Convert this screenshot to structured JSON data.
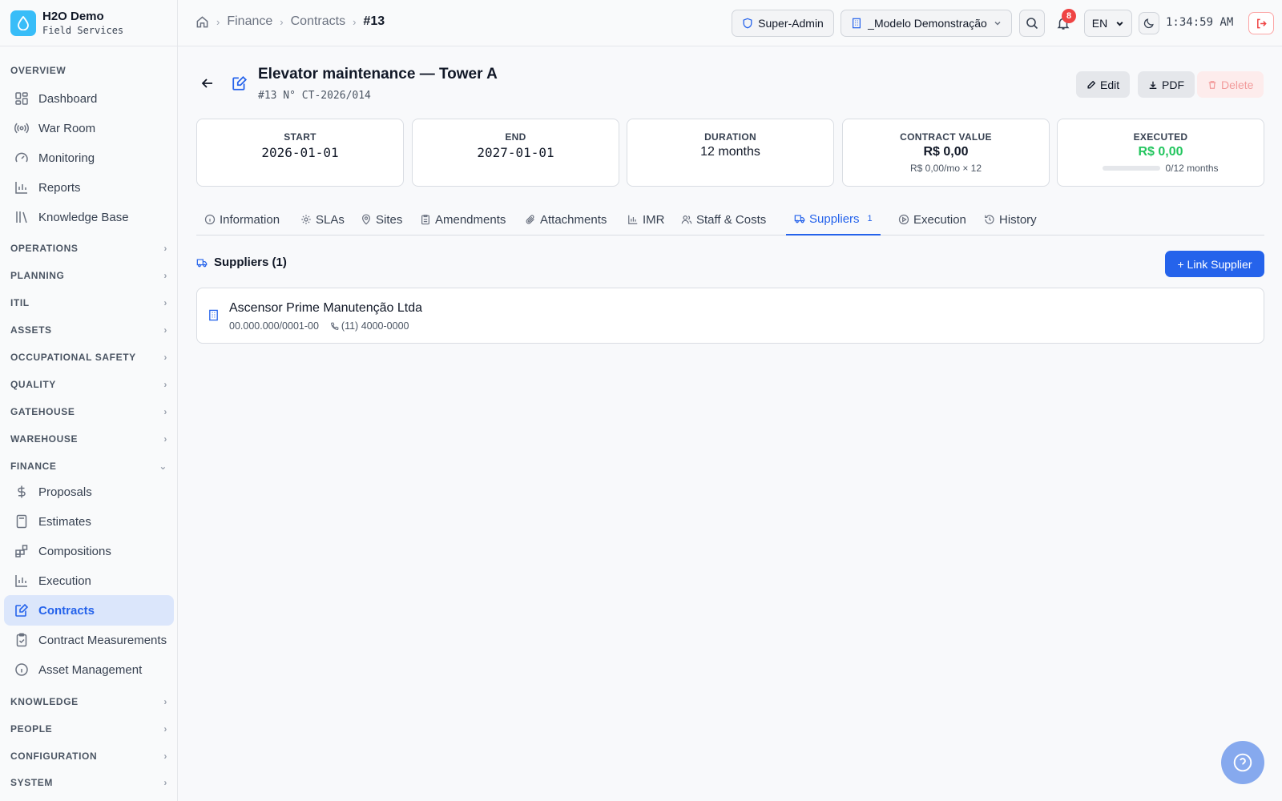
{
  "brand": {
    "name": "H2O Demo",
    "subtitle": "Field Services"
  },
  "sidebar": {
    "overview_label": "OVERVIEW",
    "overview_items": [
      {
        "label": "Dashboard",
        "icon": "dashboard-icon"
      },
      {
        "label": "War Room",
        "icon": "radio-icon"
      },
      {
        "label": "Monitoring",
        "icon": "gauge-icon"
      },
      {
        "label": "Reports",
        "icon": "bar-chart-icon"
      },
      {
        "label": "Knowledge Base",
        "icon": "library-icon"
      }
    ],
    "sections_top": [
      "OPERATIONS",
      "PLANNING",
      "ITIL",
      "ASSETS",
      "OCCUPATIONAL SAFETY",
      "QUALITY",
      "GATEHOUSE",
      "WAREHOUSE"
    ],
    "finance_label": "FINANCE",
    "finance_items": [
      {
        "label": "Proposals",
        "icon": "dollar-icon"
      },
      {
        "label": "Estimates",
        "icon": "calculator-icon"
      },
      {
        "label": "Compositions",
        "icon": "blocks-icon"
      },
      {
        "label": "Execution",
        "icon": "bar-chart-icon"
      },
      {
        "label": "Contracts",
        "icon": "file-edit-icon",
        "active": true
      },
      {
        "label": "Contract Measurements",
        "icon": "clipboard-check-icon"
      },
      {
        "label": "Asset Management",
        "icon": "info-icon"
      }
    ],
    "sections_bottom": [
      "KNOWLEDGE",
      "PEOPLE",
      "CONFIGURATION",
      "SYSTEM"
    ]
  },
  "topbar": {
    "breadcrumb": [
      "Finance",
      "Contracts",
      "#13"
    ],
    "role": "Super-Admin",
    "company": "_Modelo Demonstração",
    "notifications": "8",
    "language": "EN",
    "time": "1:34:59 AM"
  },
  "contract": {
    "title": "Elevator maintenance — Tower A",
    "subtitle": "#13 N° CT-2026/014",
    "actions": {
      "edit": "Edit",
      "pdf": "PDF",
      "delete": "Delete"
    }
  },
  "stats": {
    "start": {
      "label": "START",
      "value": "2026-01-01"
    },
    "end": {
      "label": "END",
      "value": "2027-01-01"
    },
    "duration": {
      "label": "DURATION",
      "value": "12 months"
    },
    "contract_value": {
      "label": "CONTRACT VALUE",
      "value": "R$ 0,00",
      "sub": "R$ 0,00/mo × 12"
    },
    "executed": {
      "label": "EXECUTED",
      "value": "R$ 0,00",
      "progress_text": "0/12 months",
      "progress_fraction": 0
    }
  },
  "tabs": [
    {
      "label": "Information",
      "icon": "info-icon"
    },
    {
      "label": "SLAs",
      "icon": "gear-icon"
    },
    {
      "label": "Sites",
      "icon": "map-pin-icon"
    },
    {
      "label": "Amendments",
      "icon": "clipboard-icon"
    },
    {
      "label": "Attachments",
      "icon": "paperclip-icon"
    },
    {
      "label": "IMR",
      "icon": "bar-chart-icon"
    },
    {
      "label": "Staff & Costs",
      "icon": "users-icon"
    },
    {
      "label": "Suppliers",
      "icon": "truck-icon",
      "count": "1",
      "active": true
    },
    {
      "label": "Execution",
      "icon": "play-circle-icon"
    },
    {
      "label": "History",
      "icon": "history-icon"
    }
  ],
  "suppliers": {
    "title": "Suppliers (1)",
    "link_button": "+ Link Supplier",
    "items": [
      {
        "name": "Ascensor Prime Manutenção Ltda",
        "document": "00.000.000/0001-00",
        "phone": "(11) 4000-0000"
      }
    ]
  },
  "colors": {
    "accent": "#2563eb",
    "success": "#22c55e",
    "danger": "#ef4444",
    "brand": "#38bdf8"
  }
}
